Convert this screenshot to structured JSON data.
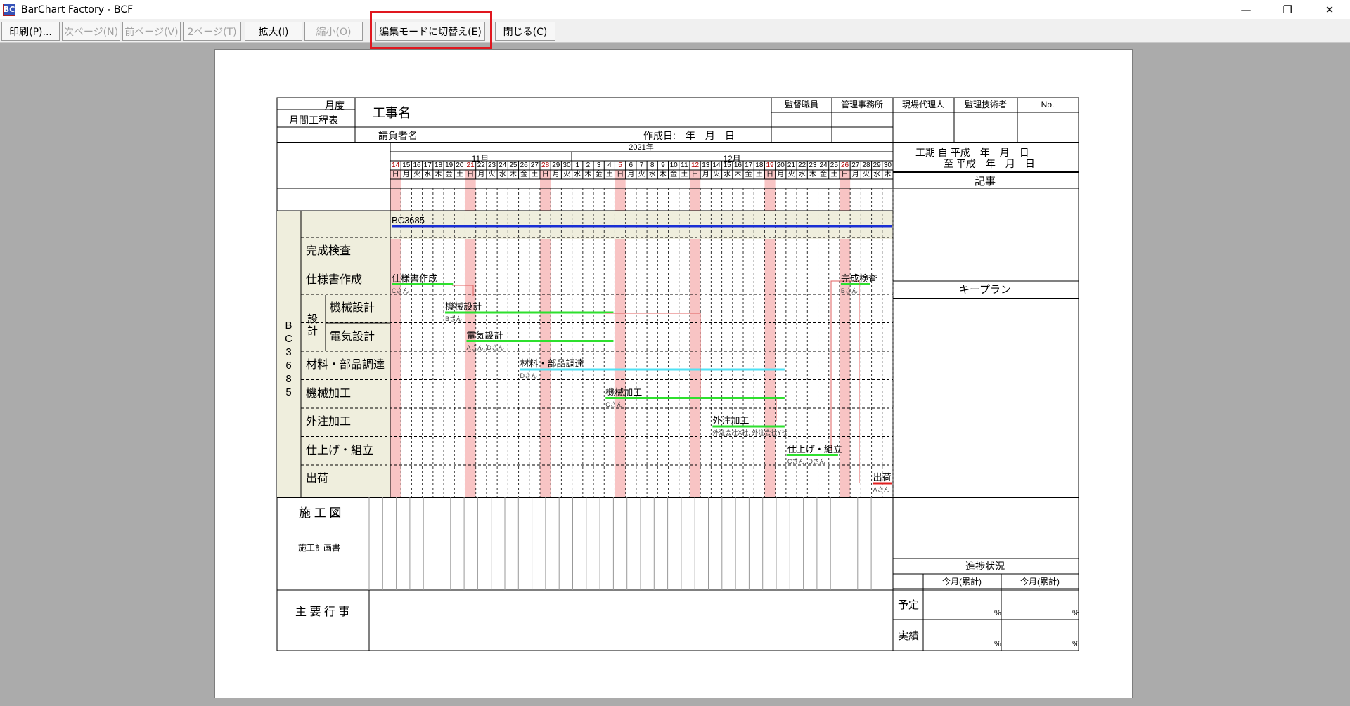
{
  "window": {
    "title": "BarChart Factory - BCF",
    "icon_label": "BC"
  },
  "toolbar": {
    "print": "印刷(P)...",
    "next_page": "次ページ(N)",
    "prev_page": "前ページ(V)",
    "two_page": "2ページ(T)",
    "zoom_in": "拡大(I)",
    "zoom_out": "縮小(O)",
    "edit_mode": "編集モードに切替え(E)",
    "close": "閉じる(C)"
  },
  "sheet": {
    "month_label": "月度",
    "schedule_label": "月間工程表",
    "project_name_label": "工事名",
    "contractor_label": "請負者名",
    "created_label": "作成日:　年　月　日",
    "approvals": [
      "監督職員",
      "管理事務所",
      "現場代理人",
      "監理技術者",
      "No."
    ],
    "year_label": "2021年",
    "months": [
      "11月",
      "12月"
    ],
    "period_from": "工期 自 平成　年　月　日",
    "period_to": "至 平成　年　月　日",
    "notes_label": "記事",
    "keyplan_label": "キープラン",
    "progress_label": "進捗状況",
    "progress_cols": [
      "今月(累計)",
      "今月(累計)"
    ],
    "progress_rows": [
      "予定",
      "実績"
    ],
    "percent": "%",
    "drawings_label": "施 工 図",
    "plan_doc_label": "施工計画書",
    "events_label": "主 要 行 事",
    "project_code": "BC3685",
    "group_label": "BC3685",
    "design_label": "設計",
    "days": [
      {
        "d": "14",
        "w": "日"
      },
      {
        "d": "15",
        "w": "月"
      },
      {
        "d": "16",
        "w": "火"
      },
      {
        "d": "17",
        "w": "水"
      },
      {
        "d": "18",
        "w": "木"
      },
      {
        "d": "19",
        "w": "金"
      },
      {
        "d": "20",
        "w": "土"
      },
      {
        "d": "21",
        "w": "日"
      },
      {
        "d": "22",
        "w": "月"
      },
      {
        "d": "23",
        "w": "火"
      },
      {
        "d": "24",
        "w": "水"
      },
      {
        "d": "25",
        "w": "木"
      },
      {
        "d": "26",
        "w": "金"
      },
      {
        "d": "27",
        "w": "土"
      },
      {
        "d": "28",
        "w": "日"
      },
      {
        "d": "29",
        "w": "月"
      },
      {
        "d": "30",
        "w": "火"
      },
      {
        "d": "1",
        "w": "水"
      },
      {
        "d": "2",
        "w": "木"
      },
      {
        "d": "3",
        "w": "金"
      },
      {
        "d": "4",
        "w": "土"
      },
      {
        "d": "5",
        "w": "日"
      },
      {
        "d": "6",
        "w": "月"
      },
      {
        "d": "7",
        "w": "火"
      },
      {
        "d": "8",
        "w": "水"
      },
      {
        "d": "9",
        "w": "木"
      },
      {
        "d": "10",
        "w": "金"
      },
      {
        "d": "11",
        "w": "土"
      },
      {
        "d": "12",
        "w": "日"
      },
      {
        "d": "13",
        "w": "月"
      },
      {
        "d": "14",
        "w": "火"
      },
      {
        "d": "15",
        "w": "水"
      },
      {
        "d": "16",
        "w": "木"
      },
      {
        "d": "17",
        "w": "金"
      },
      {
        "d": "18",
        "w": "土"
      },
      {
        "d": "19",
        "w": "日"
      },
      {
        "d": "20",
        "w": "月"
      },
      {
        "d": "21",
        "w": "火"
      },
      {
        "d": "22",
        "w": "水"
      },
      {
        "d": "23",
        "w": "木"
      },
      {
        "d": "24",
        "w": "金"
      },
      {
        "d": "25",
        "w": "土"
      },
      {
        "d": "26",
        "w": "日"
      },
      {
        "d": "27",
        "w": "月"
      },
      {
        "d": "28",
        "w": "火"
      },
      {
        "d": "29",
        "w": "水"
      },
      {
        "d": "30",
        "w": "木"
      }
    ],
    "tasks": [
      {
        "label": "完成検査"
      },
      {
        "label": "仕様書作成"
      },
      {
        "label": "機械設計"
      },
      {
        "label": "電気設計"
      },
      {
        "label": "材料・部品調達"
      },
      {
        "label": "機械加工"
      },
      {
        "label": "外注加工"
      },
      {
        "label": "仕上げ・組立"
      },
      {
        "label": "出荷"
      }
    ],
    "bars": [
      {
        "name": "BC3685",
        "color": "#1a2fd4",
        "row": -1,
        "start": 1,
        "end": 47,
        "assignee": ""
      },
      {
        "name": "仕様書作成",
        "color": "#2ee02e",
        "row": 1,
        "start": 1,
        "end": 6,
        "assignee": "Cさん"
      },
      {
        "name": "機械設計",
        "color": "#2ee02e",
        "row": 2,
        "start": 6,
        "end": 21,
        "assignee": "Bさん"
      },
      {
        "name": "電気設計",
        "color": "#2ee02e",
        "row": 3,
        "start": 8,
        "end": 21,
        "assignee": "Aさん, Dさん"
      },
      {
        "name": "材料・部品調達",
        "color": "#4fe2f5",
        "row": 4,
        "start": 13,
        "end": 37,
        "assignee": "Dさん"
      },
      {
        "name": "機械加工",
        "color": "#2ee02e",
        "row": 5,
        "start": 21,
        "end": 37,
        "assignee": "Cさん"
      },
      {
        "name": "外注加工",
        "color": "#2ee02e",
        "row": 6,
        "start": 31,
        "end": 37,
        "assignee": "外注会社X社, 外注会社Y社"
      },
      {
        "name": "仕上げ・組立",
        "color": "#2ee02e",
        "row": 7,
        "start": 38,
        "end": 42,
        "assignee": "Cさん, Dさん"
      },
      {
        "name": "完成検査",
        "color": "#2ee02e",
        "row": 1,
        "start": 43,
        "end": 45,
        "assignee": "Bさん"
      },
      {
        "name": "出荷",
        "color": "#e02020",
        "row": 8,
        "start": 46,
        "end": 47,
        "assignee": "Aさん"
      }
    ]
  },
  "colors": {
    "sunday": "#f8c4c4",
    "sunday_line": "#f3a0a0",
    "label_bg": "#efeedd",
    "link": "#e06060"
  }
}
